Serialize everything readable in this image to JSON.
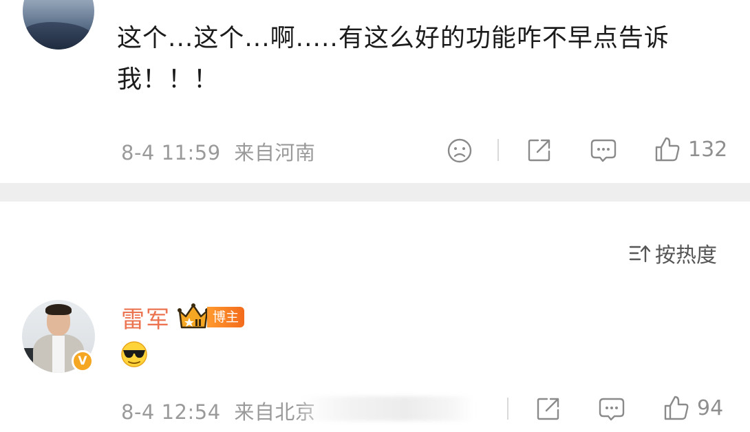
{
  "comments": [
    {
      "text": "这个...这个...啊.....有这么好的功能咋不早点告诉我！！！",
      "time": "8-4 11:59",
      "location": "来自河南",
      "likes": "132"
    },
    {
      "username": "雷军",
      "tag": "博主",
      "emoji_icon": "sunglasses-emoji-icon",
      "time": "8-4 12:54",
      "location": "来自北京",
      "likes": "94"
    }
  ],
  "sort": {
    "label": "按热度"
  },
  "colors": {
    "username": "#eb7350",
    "meta_text": "#9a9a9a",
    "band": "#eeeeee",
    "tag_bg": "#f36b1c",
    "verified_badge": "#f5a623"
  }
}
